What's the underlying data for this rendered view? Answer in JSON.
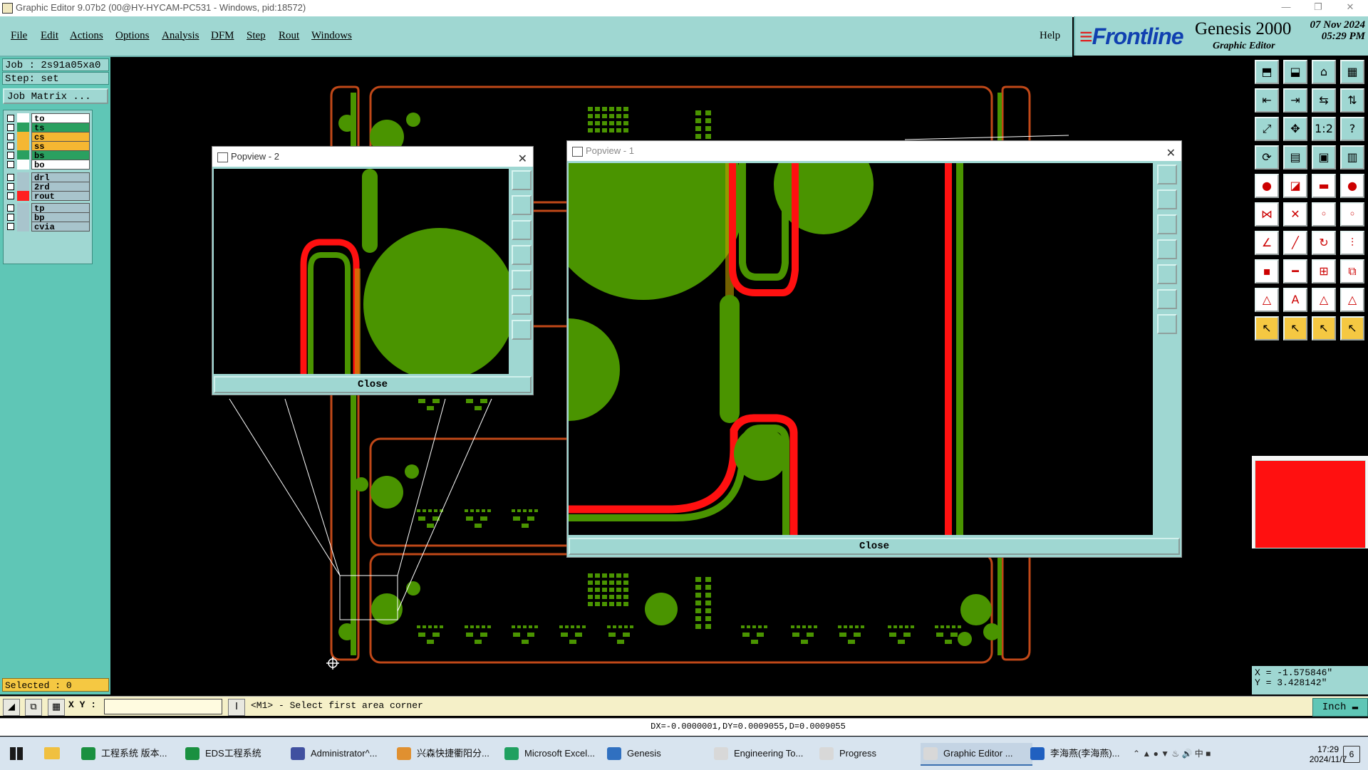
{
  "window": {
    "title": "Graphic Editor 9.07b2 (00@HY-HYCAM-PC531 - Windows, pid:18572)"
  },
  "menu": [
    "File",
    "Edit",
    "Actions",
    "Options",
    "Analysis",
    "DFM",
    "Step",
    "Rout",
    "Windows"
  ],
  "help_label": "Help",
  "brand": {
    "logo": "Frontline",
    "product": "Genesis 2000",
    "subtitle": "Graphic Editor",
    "date": "07 Nov 2024",
    "time": "05:29 PM"
  },
  "left_panel": {
    "job_line": "Job : 2s91a05xa0",
    "step_line": "Step: set",
    "job_matrix_label": "Job Matrix ...",
    "layers": [
      {
        "name": "to",
        "color": "#ffffff",
        "swatch": "#ffffff"
      },
      {
        "name": "ts",
        "color": "#2aa060",
        "swatch": "#2aa060"
      },
      {
        "name": "cs",
        "color": "#f5b732",
        "swatch": "#f5b732"
      },
      {
        "name": "ss",
        "color": "#f5b732",
        "swatch": "#f5b732"
      },
      {
        "name": "bs",
        "color": "#2aa060",
        "swatch": "#2aa060"
      },
      {
        "name": "bo",
        "color": "#ffffff",
        "swatch": "#ffffff"
      },
      {
        "name": "drl",
        "color": "#a8c4cc",
        "swatch": "#a8c4cc"
      },
      {
        "name": "2rd",
        "color": "#a8c4cc",
        "swatch": "#a8c4cc"
      },
      {
        "name": "rout",
        "color": "#a8c4cc",
        "swatch": "#ff2020"
      },
      {
        "name": "tp",
        "color": "#a8c4cc",
        "swatch": "#a8c4cc"
      },
      {
        "name": "bp",
        "color": "#a8c4cc",
        "swatch": "#a8c4cc"
      },
      {
        "name": "cvia",
        "color": "#a8c4cc",
        "swatch": "#a8c4cc"
      }
    ],
    "selected": "Selected : 0"
  },
  "popview2": {
    "title": "Popview - 2",
    "close_label": "Close"
  },
  "popview1": {
    "title": "Popview - 1",
    "close_label": "Close"
  },
  "command": {
    "xy_label": "X Y :",
    "xy_value": "",
    "prompt": "<M1> - Select first area corner",
    "units": "Inch"
  },
  "measure": "DX=-0.0000001,DY=0.0009055,D=0.0009055",
  "coords": {
    "x": "X = -1.575846\"",
    "y": "Y = 3.428142\""
  },
  "taskbar": {
    "items": [
      "工程系统  版本...",
      "EDS工程系统",
      "Administrator^...",
      "兴森快捷衢阳分...",
      "Microsoft Excel...",
      "Genesis",
      "Engineering To...",
      "Progress",
      "Graphic Editor ...",
      "李海燕(李海燕)..."
    ],
    "time": "17:29",
    "date": "2024/11/7",
    "notification_count": "6"
  },
  "colors": {
    "copper": "#4a9400",
    "rout": "#ff1010",
    "outline": "#c04818",
    "panel": "#9fd7d2",
    "accent": "#5fc6b6"
  }
}
